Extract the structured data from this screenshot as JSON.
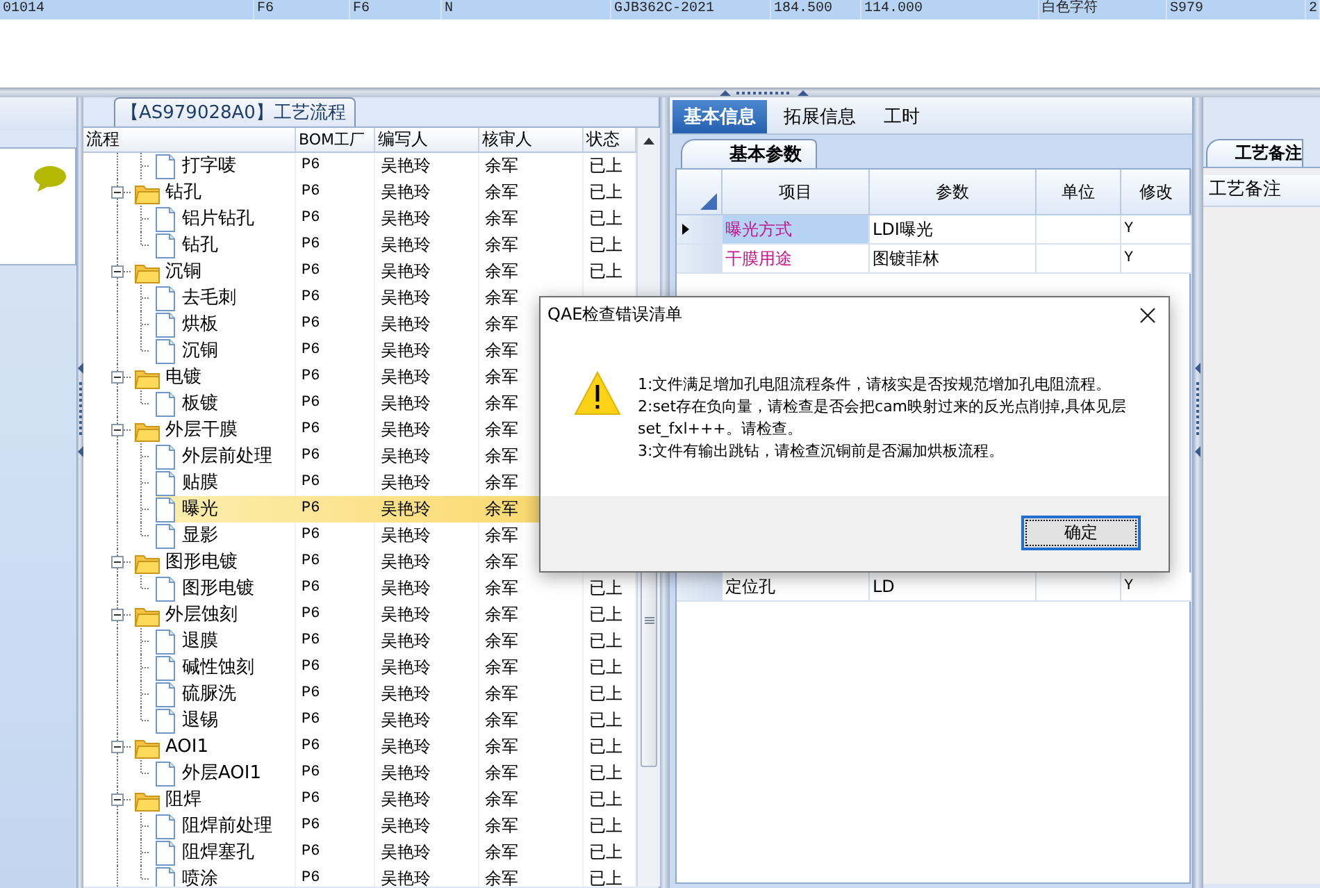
{
  "top_row": {
    "selected": true,
    "cells": [
      "01014",
      "F6",
      "F6",
      "N",
      "GJB362C-2021",
      "184.500",
      "114.000",
      "白色字符",
      "S979",
      "2"
    ]
  },
  "flow": {
    "title": "【AS979028A0】工艺流程",
    "columns": [
      "流程",
      "BOM工厂",
      "编写人",
      "核审人",
      "状态"
    ],
    "rows": [
      {
        "label": "打字唛",
        "kind": "file",
        "selected": false,
        "bom": "P6",
        "author": "吴艳玲",
        "reviewer": "余军",
        "status": "已上"
      },
      {
        "label": "钻孔",
        "kind": "folder",
        "expanded": true,
        "selected": false,
        "bom": "P6",
        "author": "吴艳玲",
        "reviewer": "余军",
        "status": "已上",
        "children": [
          {
            "label": "铝片钻孔",
            "kind": "file",
            "selected": false,
            "bom": "P6",
            "author": "吴艳玲",
            "reviewer": "余军",
            "status": "已上"
          },
          {
            "label": "钻孔",
            "kind": "file",
            "selected": false,
            "bom": "P6",
            "author": "吴艳玲",
            "reviewer": "余军",
            "status": "已上"
          }
        ]
      },
      {
        "label": "沉铜",
        "kind": "folder",
        "expanded": true,
        "selected": false,
        "bom": "P6",
        "author": "吴艳玲",
        "reviewer": "余军",
        "status": "已上",
        "children": [
          {
            "label": "去毛刺",
            "kind": "file",
            "selected": false,
            "bom": "P6",
            "author": "吴艳玲",
            "reviewer": "余军"
          },
          {
            "label": "烘板",
            "kind": "file",
            "selected": false,
            "bom": "P6",
            "author": "吴艳玲",
            "reviewer": "余军"
          },
          {
            "label": "沉铜",
            "kind": "file",
            "selected": false,
            "bom": "P6",
            "author": "吴艳玲",
            "reviewer": "余军"
          }
        ]
      },
      {
        "label": "电镀",
        "kind": "folder",
        "expanded": true,
        "selected": false,
        "bom": "P6",
        "author": "吴艳玲",
        "reviewer": "余军",
        "children": [
          {
            "label": "板镀",
            "kind": "file",
            "selected": false,
            "bom": "P6",
            "author": "吴艳玲",
            "reviewer": "余军"
          }
        ]
      },
      {
        "label": "外层干膜",
        "kind": "folder",
        "expanded": true,
        "selected": false,
        "bom": "P6",
        "author": "吴艳玲",
        "reviewer": "余军",
        "children": [
          {
            "label": "外层前处理",
            "kind": "file",
            "selected": false,
            "bom": "P6",
            "author": "吴艳玲",
            "reviewer": "余军"
          },
          {
            "label": "贴膜",
            "kind": "file",
            "selected": false,
            "bom": "P6",
            "author": "吴艳玲",
            "reviewer": "余军"
          },
          {
            "label": "曝光",
            "kind": "file",
            "selected": true,
            "bom": "P6",
            "author": "吴艳玲",
            "reviewer": "余军"
          },
          {
            "label": "显影",
            "kind": "file",
            "selected": false,
            "bom": "P6",
            "author": "吴艳玲",
            "reviewer": "余军"
          }
        ]
      },
      {
        "label": "图形电镀",
        "kind": "folder",
        "expanded": true,
        "selected": false,
        "bom": "P6",
        "author": "吴艳玲",
        "reviewer": "余军",
        "children": [
          {
            "label": "图形电镀",
            "kind": "file",
            "selected": false,
            "bom": "P6",
            "author": "吴艳玲",
            "reviewer": "余军",
            "status": "已上"
          }
        ]
      },
      {
        "label": "外层蚀刻",
        "kind": "folder",
        "expanded": true,
        "selected": false,
        "bom": "P6",
        "author": "吴艳玲",
        "reviewer": "余军",
        "status": "已上",
        "children": [
          {
            "label": "退膜",
            "kind": "file",
            "selected": false,
            "bom": "P6",
            "author": "吴艳玲",
            "reviewer": "余军",
            "status": "已上"
          },
          {
            "label": "碱性蚀刻",
            "kind": "file",
            "selected": false,
            "bom": "P6",
            "author": "吴艳玲",
            "reviewer": "余军",
            "status": "已上"
          },
          {
            "label": "硫脲洗",
            "kind": "file",
            "selected": false,
            "bom": "P6",
            "author": "吴艳玲",
            "reviewer": "余军",
            "status": "已上"
          },
          {
            "label": "退锡",
            "kind": "file",
            "selected": false,
            "bom": "P6",
            "author": "吴艳玲",
            "reviewer": "余军",
            "status": "已上"
          }
        ]
      },
      {
        "label": "AOI1",
        "kind": "folder",
        "expanded": true,
        "selected": false,
        "bom": "P6",
        "author": "吴艳玲",
        "reviewer": "余军",
        "status": "已上",
        "children": [
          {
            "label": "外层AOI1",
            "kind": "file",
            "selected": false,
            "bom": "P6",
            "author": "吴艳玲",
            "reviewer": "余军",
            "status": "已上"
          }
        ]
      },
      {
        "label": "阻焊",
        "kind": "folder",
        "expanded": true,
        "selected": false,
        "bom": "P6",
        "author": "吴艳玲",
        "reviewer": "余军",
        "status": "已上",
        "children": [
          {
            "label": "阻焊前处理",
            "kind": "file",
            "selected": false,
            "bom": "P6",
            "author": "吴艳玲",
            "reviewer": "余军",
            "status": "已上"
          },
          {
            "label": "阻焊塞孔",
            "kind": "file",
            "selected": false,
            "bom": "P6",
            "author": "吴艳玲",
            "reviewer": "余军",
            "status": "已上"
          },
          {
            "label": "喷涂",
            "kind": "file",
            "selected": false,
            "bom": "P6",
            "author": "吴艳玲",
            "reviewer": "余军",
            "status": "已上"
          }
        ]
      }
    ]
  },
  "info_tabs": [
    {
      "label": "基本信息",
      "selected": true
    },
    {
      "label": "拓展信息",
      "selected": false
    },
    {
      "label": "工时",
      "selected": false
    }
  ],
  "params": {
    "tab": "基本参数",
    "columns": [
      "项目",
      "参数",
      "单位",
      "修改"
    ],
    "rows": [
      {
        "item": "曝光方式",
        "value": "LDI曝光",
        "modify": "Y",
        "color": "#c0168c",
        "current": true,
        "selected": true
      },
      {
        "item": "干膜用途",
        "value": "图镀菲林",
        "modify": "Y",
        "color": "#c0168c",
        "current": false,
        "selected": false
      },
      {
        "item": "定位孔",
        "value": "LD",
        "modify": "Y",
        "color": "#000000",
        "current": false,
        "selected": false
      }
    ]
  },
  "notes": {
    "tab": "工艺备注",
    "header": "工艺备注"
  },
  "dialog": {
    "title": "QAE检查错误清单",
    "messages": [
      "1:文件满足增加孔电阻流程条件，请核实是否按规范增加孔电阻流程。",
      "2:set存在负向量，请检查是否会把cam映射过来的反光点削掉,具体见层set_fxl+++。请检查。",
      "3:文件有输出跳钻，请检查沉铜前是否漏加烘板流程。"
    ],
    "ok": "确定"
  }
}
